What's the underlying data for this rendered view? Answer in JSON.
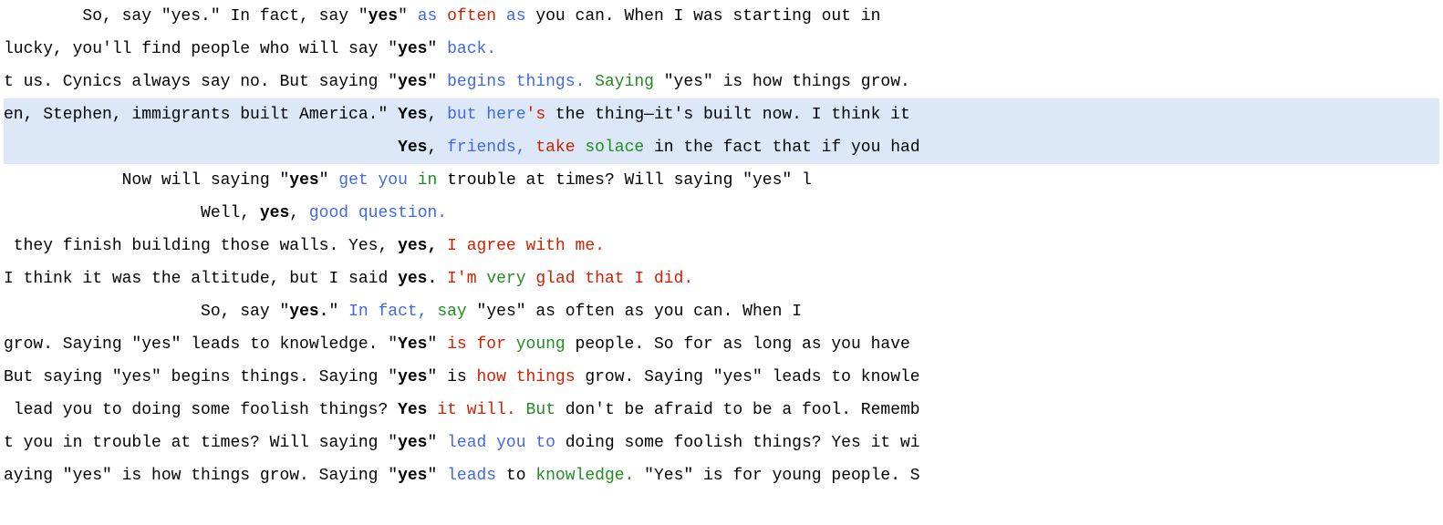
{
  "lines": [
    {
      "highlight": false,
      "segments": [
        {
          "text": "        So, say \"yes.\" In fact, say \"",
          "color": "normal",
          "bold": false
        },
        {
          "text": "yes",
          "color": "normal",
          "bold": true
        },
        {
          "text": "\" ",
          "color": "normal",
          "bold": false
        },
        {
          "text": "as ",
          "color": "blue",
          "bold": false
        },
        {
          "text": "often",
          "color": "red",
          "bold": false
        },
        {
          "text": " as",
          "color": "blue",
          "bold": false
        },
        {
          "text": " you can. When I was starting out in",
          "color": "normal",
          "bold": false
        }
      ]
    },
    {
      "highlight": false,
      "segments": [
        {
          "text": "lucky, you'll find people who will say \"",
          "color": "normal",
          "bold": false
        },
        {
          "text": "yes",
          "color": "normal",
          "bold": true
        },
        {
          "text": "\" ",
          "color": "normal",
          "bold": false
        },
        {
          "text": "back.",
          "color": "blue",
          "bold": false
        }
      ]
    },
    {
      "highlight": false,
      "segments": [
        {
          "text": "t us. Cynics always say no. But saying \"",
          "color": "normal",
          "bold": false
        },
        {
          "text": "yes",
          "color": "normal",
          "bold": true
        },
        {
          "text": "\" ",
          "color": "normal",
          "bold": false
        },
        {
          "text": "begins things.",
          "color": "blue",
          "bold": false
        },
        {
          "text": " ",
          "color": "normal",
          "bold": false
        },
        {
          "text": "Saying",
          "color": "green",
          "bold": false
        },
        {
          "text": " \"yes\" is how things grow.",
          "color": "normal",
          "bold": false
        }
      ]
    },
    {
      "highlight": true,
      "segments": [
        {
          "text": "en, Stephen, immigrants built America.\" ",
          "color": "normal",
          "bold": false
        },
        {
          "text": "Yes",
          "color": "normal",
          "bold": true
        },
        {
          "text": ", ",
          "color": "normal",
          "bold": false
        },
        {
          "text": "but here",
          "color": "blue",
          "bold": false
        },
        {
          "text": "'s",
          "color": "red",
          "bold": false
        },
        {
          "text": " the thing—it's built now. I think it",
          "color": "normal",
          "bold": false
        }
      ]
    },
    {
      "highlight": true,
      "segments": [
        {
          "text": "                                        ",
          "color": "normal",
          "bold": false
        },
        {
          "text": "Yes",
          "color": "normal",
          "bold": true
        },
        {
          "text": ", ",
          "color": "normal",
          "bold": false
        },
        {
          "text": "friends,",
          "color": "blue",
          "bold": false
        },
        {
          "text": " ",
          "color": "normal",
          "bold": false
        },
        {
          "text": "take",
          "color": "red",
          "bold": false
        },
        {
          "text": " ",
          "color": "normal",
          "bold": false
        },
        {
          "text": "solace",
          "color": "green",
          "bold": false
        },
        {
          "text": " in the fact that if you had",
          "color": "normal",
          "bold": false
        }
      ]
    },
    {
      "highlight": false,
      "segments": [
        {
          "text": "            Now will saying \"",
          "color": "normal",
          "bold": false
        },
        {
          "text": "yes",
          "color": "normal",
          "bold": true
        },
        {
          "text": "\" ",
          "color": "normal",
          "bold": false
        },
        {
          "text": "get you",
          "color": "blue",
          "bold": false
        },
        {
          "text": " ",
          "color": "normal",
          "bold": false
        },
        {
          "text": "in",
          "color": "green",
          "bold": false
        },
        {
          "text": " trouble at times? Will saying \"yes\" l",
          "color": "normal",
          "bold": false
        }
      ]
    },
    {
      "highlight": false,
      "segments": [
        {
          "text": "                    Well, ",
          "color": "normal",
          "bold": false
        },
        {
          "text": "yes",
          "color": "normal",
          "bold": true
        },
        {
          "text": ", ",
          "color": "normal",
          "bold": false
        },
        {
          "text": "good question.",
          "color": "blue",
          "bold": false
        }
      ]
    },
    {
      "highlight": false,
      "segments": [
        {
          "text": " they finish building those walls. Yes, ",
          "color": "normal",
          "bold": false
        },
        {
          "text": "yes,",
          "color": "normal",
          "bold": true
        },
        {
          "text": " ",
          "color": "normal",
          "bold": false
        },
        {
          "text": "I agree with me.",
          "color": "red",
          "bold": false
        }
      ]
    },
    {
      "highlight": false,
      "segments": [
        {
          "text": "I think it was the altitude, but I said ",
          "color": "normal",
          "bold": false
        },
        {
          "text": "yes.",
          "color": "normal",
          "bold": true
        },
        {
          "text": " ",
          "color": "normal",
          "bold": false
        },
        {
          "text": "I'm ",
          "color": "red",
          "bold": false
        },
        {
          "text": "very",
          "color": "green",
          "bold": false
        },
        {
          "text": " glad that I did.",
          "color": "red",
          "bold": false
        }
      ]
    },
    {
      "highlight": false,
      "segments": [
        {
          "text": "                    So, say \"",
          "color": "normal",
          "bold": false
        },
        {
          "text": "yes.",
          "color": "normal",
          "bold": true
        },
        {
          "text": "\" ",
          "color": "normal",
          "bold": false
        },
        {
          "text": "In fact,",
          "color": "blue",
          "bold": false
        },
        {
          "text": " ",
          "color": "normal",
          "bold": false
        },
        {
          "text": "say",
          "color": "green",
          "bold": false
        },
        {
          "text": " \"yes\" as often as you can. When I",
          "color": "normal",
          "bold": false
        }
      ]
    },
    {
      "highlight": false,
      "segments": [
        {
          "text": "grow. Saying \"yes\" leads to knowledge. \"",
          "color": "normal",
          "bold": false
        },
        {
          "text": "Yes",
          "color": "normal",
          "bold": true
        },
        {
          "text": "\" ",
          "color": "normal",
          "bold": false
        },
        {
          "text": "is for",
          "color": "red",
          "bold": false
        },
        {
          "text": " ",
          "color": "normal",
          "bold": false
        },
        {
          "text": "young",
          "color": "green",
          "bold": false
        },
        {
          "text": " people. So for as long as you have",
          "color": "normal",
          "bold": false
        }
      ]
    },
    {
      "highlight": false,
      "segments": [
        {
          "text": "But saying \"yes\" begins things. Saying \"",
          "color": "normal",
          "bold": false
        },
        {
          "text": "yes",
          "color": "normal",
          "bold": true
        },
        {
          "text": "\" is ",
          "color": "normal",
          "bold": false
        },
        {
          "text": "how things",
          "color": "red",
          "bold": false
        },
        {
          "text": " grow. Saying \"yes\" leads to knowle",
          "color": "normal",
          "bold": false
        }
      ]
    },
    {
      "highlight": false,
      "segments": [
        {
          "text": " lead you to doing some foolish things? ",
          "color": "normal",
          "bold": false
        },
        {
          "text": "Yes",
          "color": "normal",
          "bold": true
        },
        {
          "text": " ",
          "color": "normal",
          "bold": false
        },
        {
          "text": "it will.",
          "color": "red",
          "bold": false
        },
        {
          "text": " ",
          "color": "normal",
          "bold": false
        },
        {
          "text": "But",
          "color": "green",
          "bold": false
        },
        {
          "text": " don't be afraid to be a fool. Rememb",
          "color": "normal",
          "bold": false
        }
      ]
    },
    {
      "highlight": false,
      "segments": [
        {
          "text": "t you in trouble at times? Will saying \"",
          "color": "normal",
          "bold": false
        },
        {
          "text": "yes",
          "color": "normal",
          "bold": true
        },
        {
          "text": "\" ",
          "color": "normal",
          "bold": false
        },
        {
          "text": "lead you to",
          "color": "blue",
          "bold": false
        },
        {
          "text": " doing some foolish things? Yes it wi",
          "color": "normal",
          "bold": false
        }
      ]
    },
    {
      "highlight": false,
      "segments": [
        {
          "text": "aying \"yes\" is how things grow. Saying \"",
          "color": "normal",
          "bold": false
        },
        {
          "text": "yes",
          "color": "normal",
          "bold": true
        },
        {
          "text": "\" ",
          "color": "normal",
          "bold": false
        },
        {
          "text": "leads",
          "color": "blue",
          "bold": false
        },
        {
          "text": " to ",
          "color": "normal",
          "bold": false
        },
        {
          "text": "knowledge.",
          "color": "green",
          "bold": false
        },
        {
          "text": " \"Yes\" is for young people. S",
          "color": "normal",
          "bold": false
        }
      ]
    }
  ]
}
